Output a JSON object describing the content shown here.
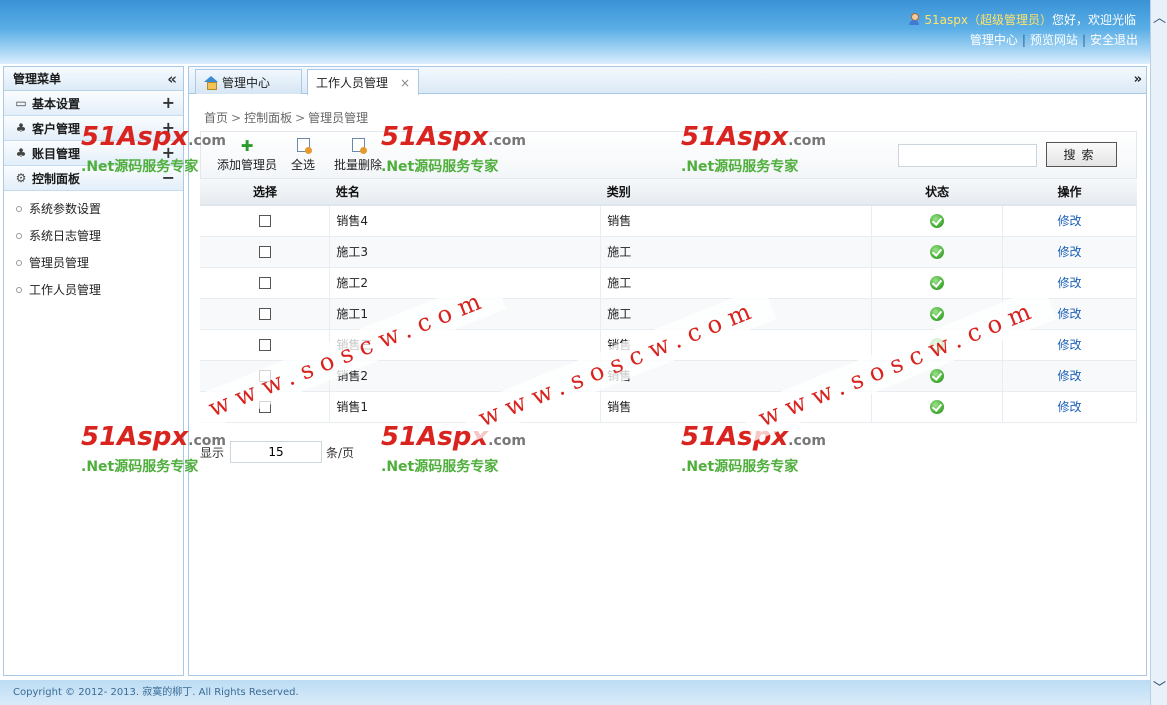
{
  "header": {
    "user_name": "51aspx（超级管理员）",
    "greeting": "您好，欢迎光临",
    "links": [
      "管理中心",
      "预览网站",
      "安全退出"
    ]
  },
  "sidebar": {
    "title": "管理菜单",
    "groups": [
      {
        "label": "基本设置",
        "toggle": "+"
      },
      {
        "label": "客户管理",
        "toggle": "+"
      },
      {
        "label": "账目管理",
        "toggle": "+"
      },
      {
        "label": "控制面板",
        "toggle": "−"
      }
    ],
    "items": [
      "系统参数设置",
      "系统日志管理",
      "管理员管理",
      "工作人员管理"
    ]
  },
  "tabs": [
    {
      "label": "管理中心"
    },
    {
      "label": "工作人员管理",
      "close": "×"
    }
  ],
  "breadcrumb": [
    "首页",
    "控制面板",
    "管理员管理"
  ],
  "toolbar": {
    "add_label": "添加管理员",
    "select_all_label": "全选",
    "batch_delete_label": "批量删除",
    "search_placeholder": "",
    "search_label": "搜索"
  },
  "table": {
    "headers": [
      "选择",
      "姓名",
      "类别",
      "状态",
      "操作"
    ],
    "rows": [
      {
        "name": "销售4",
        "type": "销售",
        "action": "修改"
      },
      {
        "name": "施工3",
        "type": "施工",
        "action": "修改"
      },
      {
        "name": "施工2",
        "type": "施工",
        "action": "修改"
      },
      {
        "name": "施工1",
        "type": "施工",
        "action": "修改"
      },
      {
        "name": "销售三",
        "type": "销售",
        "action": "修改"
      },
      {
        "name": "销售2",
        "type": "销售",
        "action": "修改"
      },
      {
        "name": "销售1",
        "type": "销售",
        "action": "修改"
      }
    ]
  },
  "pager": {
    "prefix": "显示",
    "page_size": "15",
    "suffix": "条/页"
  },
  "footer": {
    "copyright": "Copyright © 2012- 2013. 寂寞的柳丁. All Rights Reserved."
  },
  "watermarks": {
    "logo": "51Aspx",
    "logo_domain": ".com",
    "slogan": ".Net源码服务专家",
    "url": "www.soscw.com"
  },
  "colors": {
    "header_blue": "#3a93d6",
    "link_blue": "#1a5fb4",
    "status_green": "#3da62e",
    "watermark_red": "#d8231f",
    "watermark_green": "#4fae3c"
  }
}
